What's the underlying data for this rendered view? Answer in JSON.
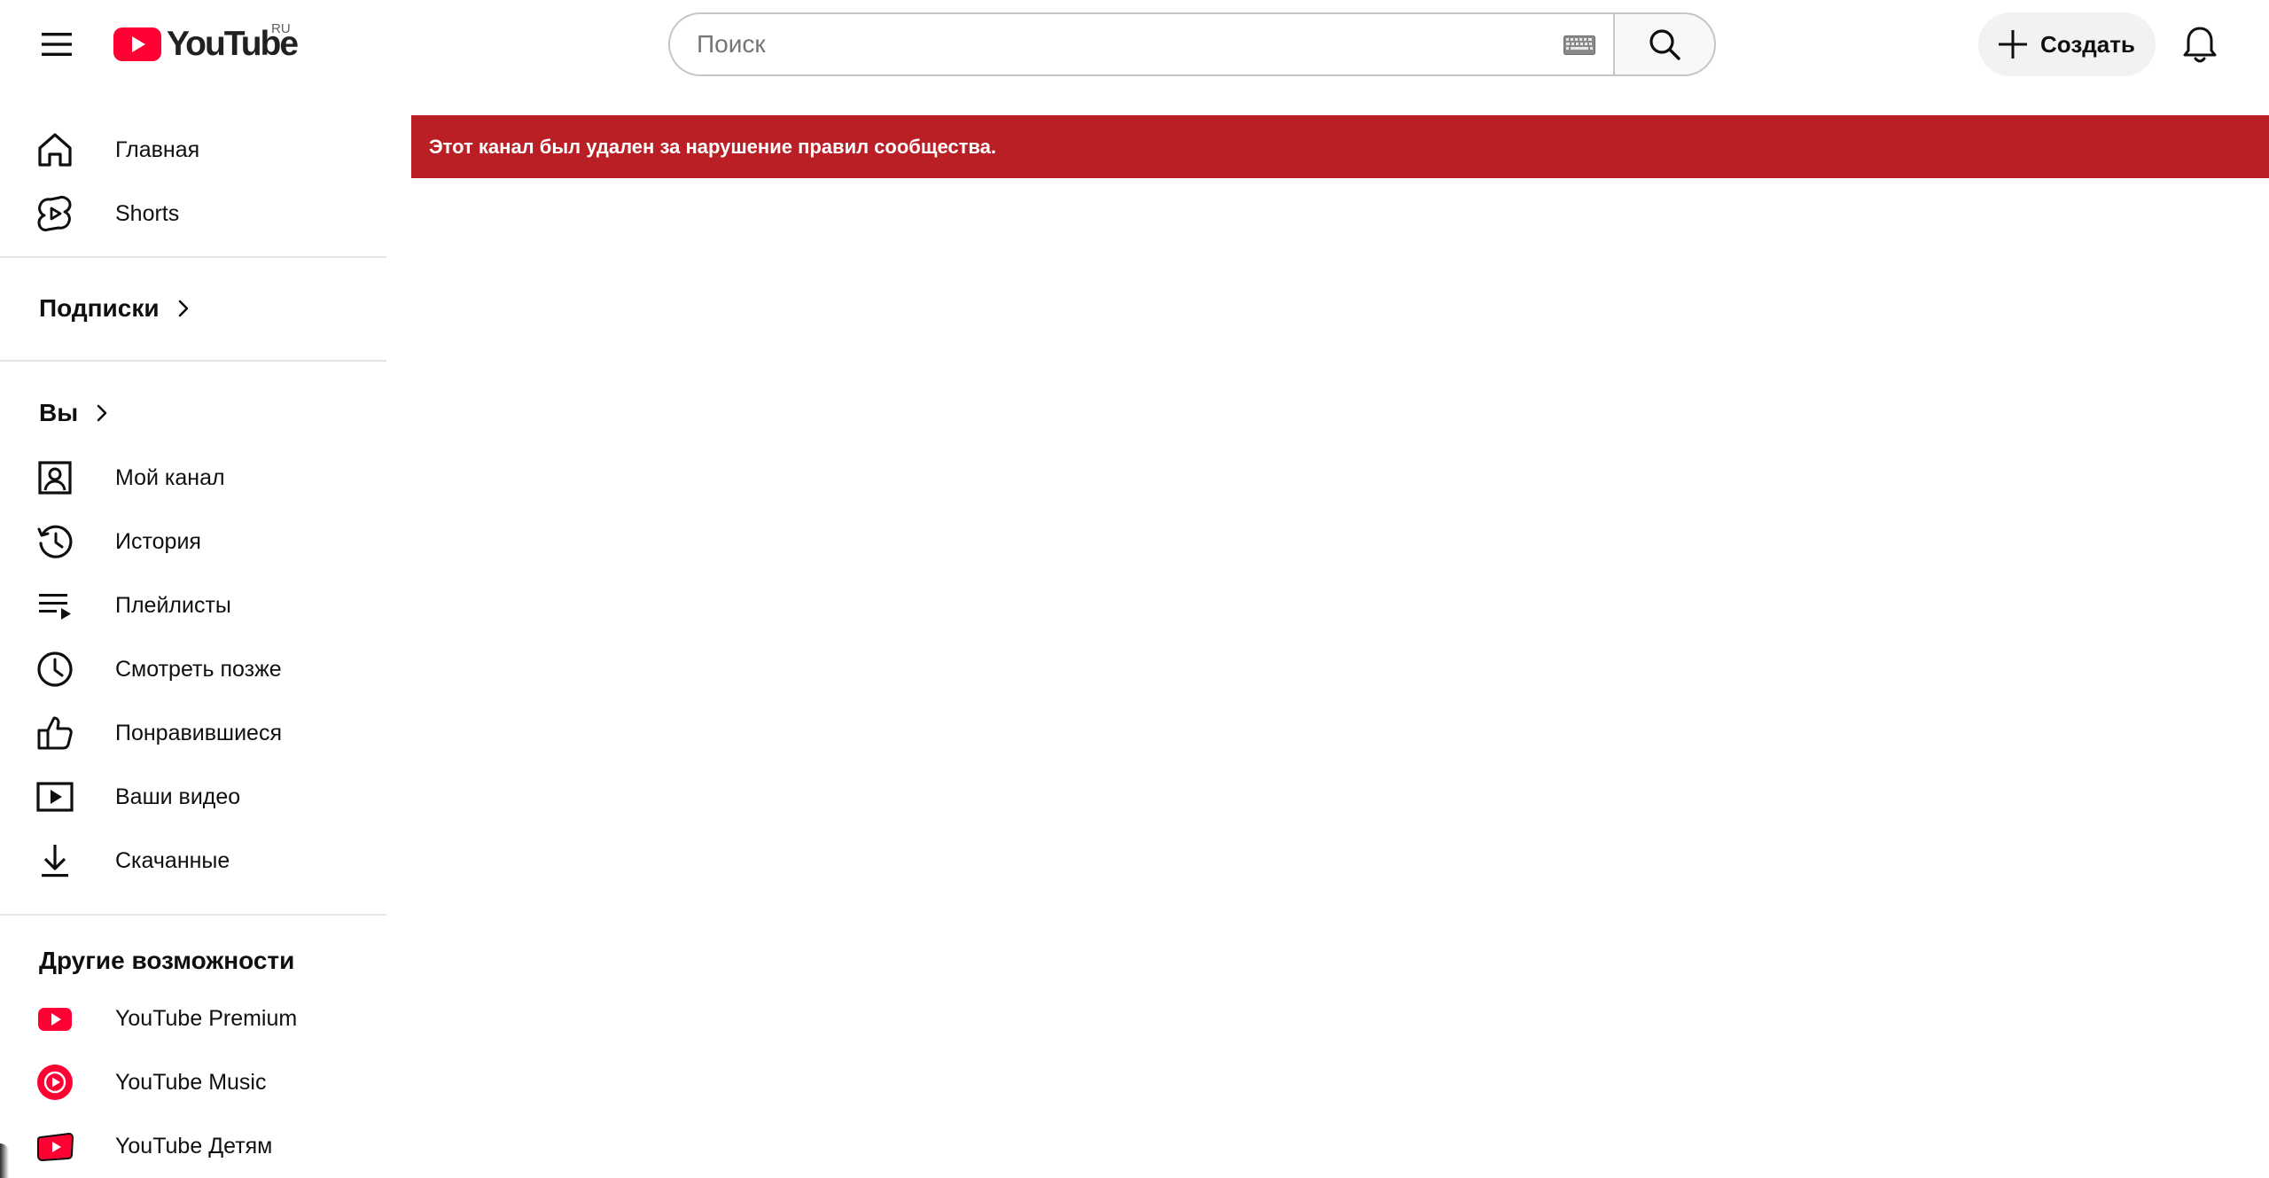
{
  "header": {
    "logo_text": "YouTube",
    "country_code": "RU",
    "search_placeholder": "Поиск",
    "create_label": "Создать"
  },
  "sidebar": {
    "main": [
      {
        "label": "Главная",
        "icon": "home-icon"
      },
      {
        "label": "Shorts",
        "icon": "shorts-icon"
      }
    ],
    "subscriptions_title": "Подписки",
    "you_title": "Вы",
    "you_items": [
      {
        "label": "Мой канал",
        "icon": "my-channel-icon"
      },
      {
        "label": "История",
        "icon": "history-icon"
      },
      {
        "label": "Плейлисты",
        "icon": "playlists-icon"
      },
      {
        "label": "Смотреть позже",
        "icon": "watch-later-icon"
      },
      {
        "label": "Понравившиеся",
        "icon": "thumbs-up-icon"
      },
      {
        "label": "Ваши видео",
        "icon": "your-videos-icon"
      },
      {
        "label": "Скачанные",
        "icon": "download-icon"
      }
    ],
    "more_title": "Другие возможности",
    "more_items": [
      {
        "label": "YouTube Premium",
        "icon": "youtube-premium-icon"
      },
      {
        "label": "YouTube Music",
        "icon": "youtube-music-icon"
      },
      {
        "label": "YouTube Детям",
        "icon": "youtube-kids-icon"
      }
    ]
  },
  "banner": {
    "message": "Этот канал был удален за нарушение правил сообщества."
  },
  "colors": {
    "brand_red": "#ff0033",
    "banner_red": "#b91f24",
    "text": "#0f0f0f",
    "divider": "#e5e5e5"
  }
}
